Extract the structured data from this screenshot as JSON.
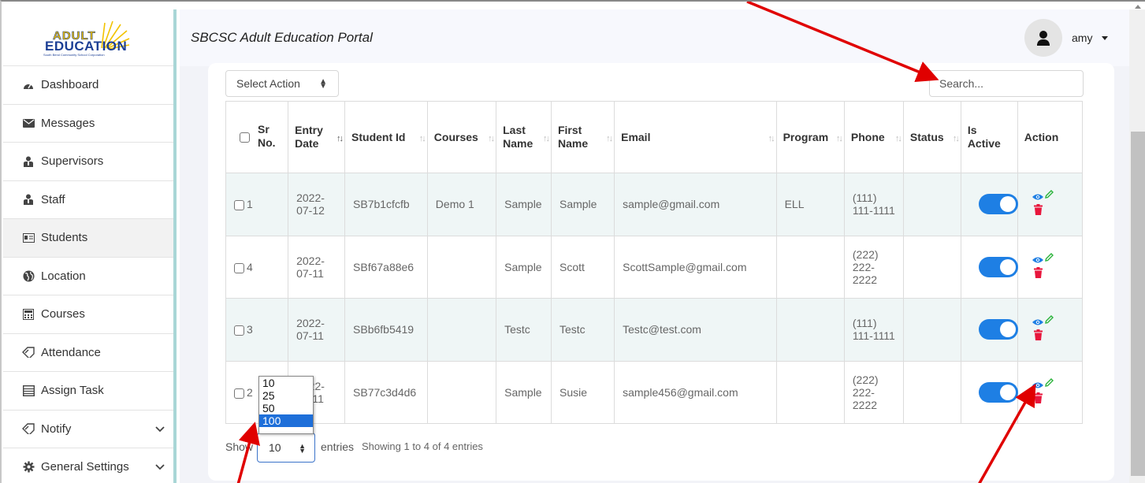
{
  "app": {
    "title": "SBCSC Adult Education Portal",
    "logo": {
      "top": "ADULT",
      "main": "EDUCATION",
      "sub": "South Bend Community School Corporation"
    }
  },
  "user": {
    "name": "amy"
  },
  "sidebar": {
    "items": [
      {
        "label": "Dashboard",
        "icon": "dashboard-icon"
      },
      {
        "label": "Messages",
        "icon": "envelope-icon"
      },
      {
        "label": "Supervisors",
        "icon": "users-icon"
      },
      {
        "label": "Staff",
        "icon": "users-icon"
      },
      {
        "label": "Students",
        "icon": "id-card-icon"
      },
      {
        "label": "Location",
        "icon": "globe-icon"
      },
      {
        "label": "Courses",
        "icon": "calculator-icon"
      },
      {
        "label": "Attendance",
        "icon": "tag-icon"
      },
      {
        "label": "Assign Task",
        "icon": "list-icon"
      },
      {
        "label": "Notify",
        "icon": "tag-icon"
      },
      {
        "label": "General Settings",
        "icon": "gear-icon"
      }
    ]
  },
  "toolbar": {
    "select_action": "Select Action",
    "search_placeholder": "Search..."
  },
  "table": {
    "headers": {
      "sr": "Sr No.",
      "entry_date": "Entry Date",
      "student_id": "Student Id",
      "courses": "Courses",
      "last_name": "Last Name",
      "first_name": "First Name",
      "email": "Email",
      "program": "Program",
      "phone": "Phone",
      "status": "Status",
      "is_active": "Is Active",
      "action": "Action"
    },
    "rows": [
      {
        "sr": "1",
        "entry_date": "2022-07-12",
        "student_id": "SB7b1cfcfb",
        "courses": "Demo 1",
        "last_name": "Sample",
        "first_name": "Sample",
        "email": "sample@gmail.com",
        "program": "ELL",
        "phone": "(111) 111-1111",
        "is_active": true
      },
      {
        "sr": "4",
        "entry_date": "2022-07-11",
        "student_id": "SBf67a88e6",
        "courses": "",
        "last_name": "Sample",
        "first_name": "Scott",
        "email": "ScottSample@gmail.com",
        "program": "",
        "phone": "(222) 222-2222",
        "is_active": true
      },
      {
        "sr": "3",
        "entry_date": "2022-07-11",
        "student_id": "SBb6fb5419",
        "courses": "",
        "last_name": "Testc",
        "first_name": "Testc",
        "email": "Testc@test.com",
        "program": "",
        "phone": "(111) 111-1111",
        "is_active": true
      },
      {
        "sr": "2",
        "entry_date": "2022-07-11",
        "student_id": "SB77c3d4d6",
        "courses": "",
        "last_name": "Sample",
        "first_name": "Susie",
        "email": "sample456@gmail.com",
        "program": "",
        "phone": "(222) 222-2222",
        "is_active": true
      }
    ]
  },
  "footer": {
    "show_label": "Show",
    "page_length": "10",
    "entries_label": "entries",
    "info": "Showing 1 to 4 of 4 entries",
    "length_options": [
      "10",
      "25",
      "50",
      "100"
    ],
    "highlighted_option": "100"
  },
  "colors": {
    "accent": "#1e7fe4",
    "row_stripe": "#eff6f6",
    "sidebar_border": "#a9d6d6",
    "delete": "#e8163c",
    "edit": "#2bb33b",
    "annotation": "#e00000"
  }
}
